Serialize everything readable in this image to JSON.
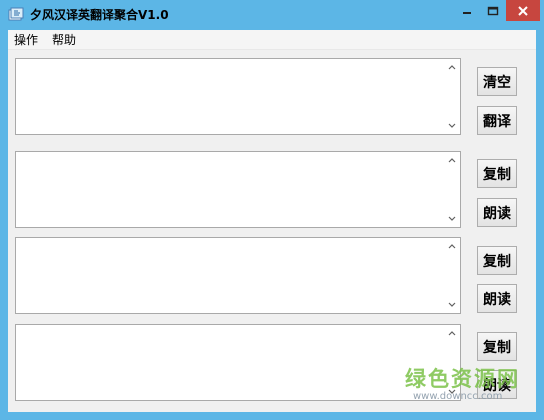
{
  "window": {
    "title": "夕风汉译英翻译聚合V1.0",
    "titlebar_color": "#5cb6e6",
    "close_color": "#c7463f"
  },
  "menu": {
    "items": [
      {
        "label": "操作"
      },
      {
        "label": "帮助"
      }
    ]
  },
  "panels": [
    {
      "text": "",
      "buttons": [
        {
          "label": "清空"
        },
        {
          "label": "翻译"
        }
      ]
    },
    {
      "text": "",
      "buttons": [
        {
          "label": "复制"
        },
        {
          "label": "朗读"
        }
      ]
    },
    {
      "text": "",
      "buttons": [
        {
          "label": "复制"
        },
        {
          "label": "朗读"
        }
      ]
    },
    {
      "text": "",
      "buttons": [
        {
          "label": "复制"
        },
        {
          "label": "朗读"
        }
      ]
    }
  ],
  "watermark": {
    "text": "绿色资源网",
    "url": "www.downcc.com",
    "color": "#7cc24a"
  }
}
